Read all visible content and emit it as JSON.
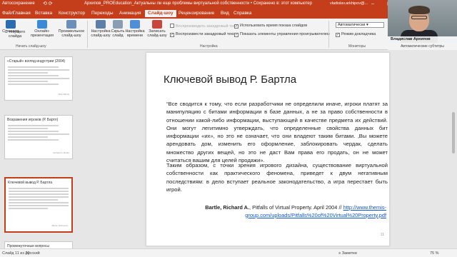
{
  "titlebar": {
    "autosave": "Автосохранение",
    "quick_access": "⟲ ⟳",
    "document": "Архипов_PROEducation_Актуальны ли еще проблемы виртуальной собственности • Сохранено в: этот компьютер",
    "email": "vladislav.arkhipov@...",
    "window_buttons": "– ▢ ✕"
  },
  "tabs": [
    {
      "label": "Файл"
    },
    {
      "label": "Главная"
    },
    {
      "label": "Вставка"
    },
    {
      "label": "Конструктор"
    },
    {
      "label": "Переходы"
    },
    {
      "label": "Анимация"
    },
    {
      "label": "Слайд-шоу"
    },
    {
      "label": "Рецензирование"
    },
    {
      "label": "Вид"
    },
    {
      "label": "Справка"
    }
  ],
  "ribbon": {
    "buttons": [
      {
        "label": "С начала"
      },
      {
        "label": "С текущего слайда"
      },
      {
        "label": "Онлайн-презентация"
      },
      {
        "label": "Произвольное слайд-шоу"
      },
      {
        "label": "Настройка слайд-шоу"
      },
      {
        "label": "Скрыть слайд"
      },
      {
        "label": "Настройка времени"
      },
      {
        "label": "Записать слайд-шоу"
      }
    ],
    "group_start": "Начать слайд-шоу",
    "group_setup": "Настройка",
    "group_monitors": "Мониторы",
    "checks": {
      "rehearse": "Воспроизвести закадровый текст",
      "use_timings": "Использовать время показа слайдов",
      "show_media": "Показать элементы управления проигрывателем",
      "presenter_view": "Режим докладчика",
      "dim_label": "Воспроизводить закадровый текст"
    },
    "monitor_select": "Автоматически"
  },
  "webcam": {
    "name": "Владислав Архипов",
    "subtitle": "Автоматические субтитры"
  },
  "thumbnails": [
    {
      "title": "«Старый» взгляд индустрии (2004)",
      "credit": "Matt Mihaly"
    },
    {
      "title": "Возражения игроков (Р. Бартл)",
      "credit": "Richard A. Bartle"
    },
    {
      "title": "Ключевой вывод Р. Бартла",
      "credit": "Bartle, Richard A."
    },
    {
      "title": "Промежуточные вопросы"
    }
  ],
  "slide": {
    "title": "Ключевой вывод Р. Бартла",
    "paragraph1": "“Все сводится к тому, что если разработчики не определили иначе, игроки платят за манипуляцию с битами информации в базе данных, а не за право собственности в отношении какой-либо информации, выступающей в качестве предмета их действий. Они могут легитимно утверждать, что определенные свойства данных бит информации «их», но это не означает, что они владеют таким битами. ‚Вы можете арендовать дом, изменить его оформление, заблокировать чердак, сделать множество других вещей, но это не даст Вам права его продать, он не может считаться вашим для целей продажи».",
    "paragraph2": "Таким образом, с точки зрения игрового дизайна, существование виртуальной собственности как практического феномена, приведет к двум негативным последствиям: в дело вступает реальное законодательство, а игра перестает быть игрой.",
    "ref_author": "Bartle, Richard A.",
    "ref_text": ", Pitfalls of Virtual Property. April 2004 // ",
    "ref_link": "http://www.themis-group.com/uploads/Pitfalls%20of%20Virtual%20Property.pdf",
    "number": "11"
  },
  "statusbar": {
    "slide": "Слайд 11 из 20",
    "language": "русский",
    "notes": "≡ Заметки",
    "zoom": "75 %"
  },
  "colors": {
    "accent": "#c43e1c",
    "link": "#1155cc"
  }
}
